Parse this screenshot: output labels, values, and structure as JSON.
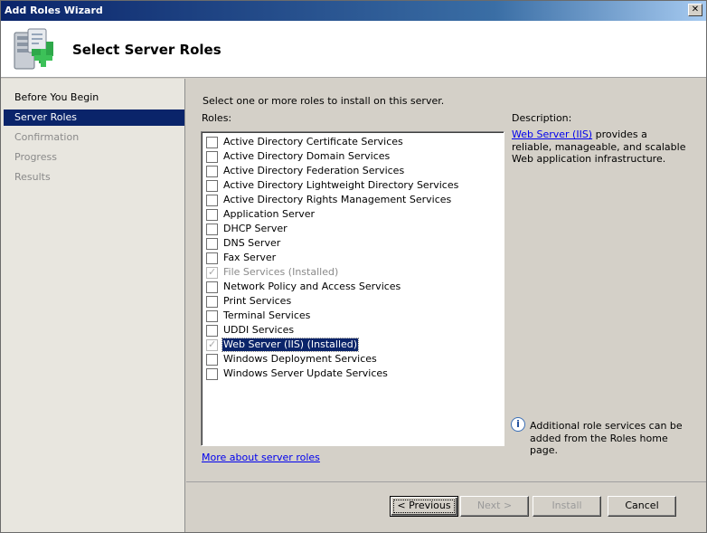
{
  "window": {
    "title": "Add Roles Wizard",
    "close_glyph": "✕"
  },
  "header": {
    "title": "Select Server Roles",
    "icon": "server-roles-icon"
  },
  "sidebar": {
    "items": [
      {
        "label": "Before You Begin",
        "state": "done"
      },
      {
        "label": "Server Roles",
        "state": "active"
      },
      {
        "label": "Confirmation",
        "state": "pending"
      },
      {
        "label": "Progress",
        "state": "pending"
      },
      {
        "label": "Results",
        "state": "pending"
      }
    ]
  },
  "main": {
    "instruction": "Select one or more roles to install on this server.",
    "roles_label": "Roles:",
    "roles": [
      {
        "label": "Active Directory Certificate Services",
        "checked": false,
        "installed": false
      },
      {
        "label": "Active Directory Domain Services",
        "checked": false,
        "installed": false
      },
      {
        "label": "Active Directory Federation Services",
        "checked": false,
        "installed": false
      },
      {
        "label": "Active Directory Lightweight Directory Services",
        "checked": false,
        "installed": false
      },
      {
        "label": "Active Directory Rights Management Services",
        "checked": false,
        "installed": false
      },
      {
        "label": "Application Server",
        "checked": false,
        "installed": false
      },
      {
        "label": "DHCP Server",
        "checked": false,
        "installed": false
      },
      {
        "label": "DNS Server",
        "checked": false,
        "installed": false
      },
      {
        "label": "Fax Server",
        "checked": false,
        "installed": false
      },
      {
        "label": "File Services  (Installed)",
        "checked": true,
        "installed": true
      },
      {
        "label": "Network Policy and Access Services",
        "checked": false,
        "installed": false
      },
      {
        "label": "Print Services",
        "checked": false,
        "installed": false
      },
      {
        "label": "Terminal Services",
        "checked": false,
        "installed": false
      },
      {
        "label": "UDDI Services",
        "checked": false,
        "installed": false
      },
      {
        "label": "Web Server (IIS)  (Installed)",
        "checked": true,
        "installed": true,
        "selected": true
      },
      {
        "label": "Windows Deployment Services",
        "checked": false,
        "installed": false
      },
      {
        "label": "Windows Server Update Services",
        "checked": false,
        "installed": false
      }
    ],
    "more_link": "More about server roles"
  },
  "description": {
    "label": "Description:",
    "link_text": "Web Server (IIS)",
    "text": " provides a reliable, manageable, and scalable Web application infrastructure.",
    "info_icon": "info-icon",
    "info_text": "Additional role services can be added from the Roles home page."
  },
  "buttons": {
    "previous": "< Previous",
    "next": "Next >",
    "install": "Install",
    "cancel": "Cancel"
  }
}
